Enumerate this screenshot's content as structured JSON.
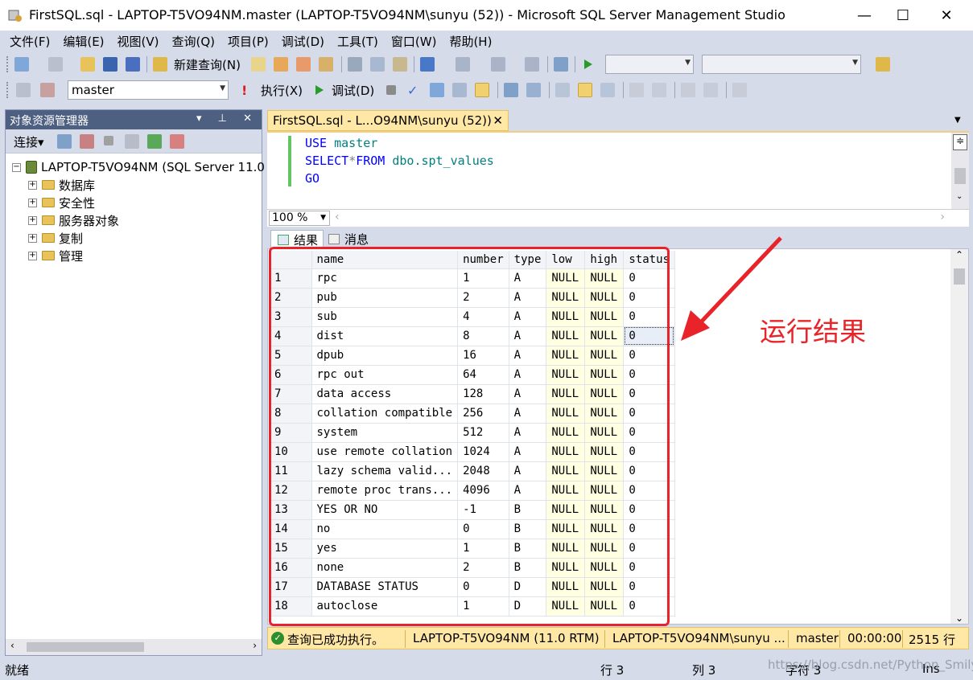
{
  "window": {
    "title": "FirstSQL.sql - LAPTOP-T5VO94NM.master (LAPTOP-T5VO94NM\\sunyu (52)) - Microsoft SQL Server Management Studio",
    "minimize": "—",
    "maximize": "☐",
    "close": "✕"
  },
  "menu": [
    "文件(F)",
    "编辑(E)",
    "视图(V)",
    "查询(Q)",
    "项目(P)",
    "调试(D)",
    "工具(T)",
    "窗口(W)",
    "帮助(H)"
  ],
  "toolbar1": {
    "new_query": "新建查询(N)"
  },
  "toolbar2": {
    "database": "master",
    "execute": "执行(X)",
    "debug": "调试(D)"
  },
  "object_explorer": {
    "title": "对象资源管理器",
    "header_buttons": "▾ 𝟦 ✕",
    "connect": "连接▾",
    "server": "LAPTOP-T5VO94NM (SQL Server 11.0",
    "nodes": [
      "数据库",
      "安全性",
      "服务器对象",
      "复制",
      "管理"
    ]
  },
  "document_tab": {
    "label": "FirstSQL.sql - L...O94NM\\sunyu (52))",
    "close": "✕"
  },
  "editor": {
    "line1_kw": "USE",
    "line1_rest": " master",
    "line2_kw1": "SELECT",
    "line2_op": "*",
    "line2_kw2": "FROM",
    "line2_obj": " dbo.spt_values",
    "line3_kw": "GO"
  },
  "zoom": "100 %",
  "result_tabs": {
    "results": "结果",
    "messages": "消息"
  },
  "grid": {
    "columns": [
      "name",
      "number",
      "type",
      "low",
      "high",
      "status"
    ],
    "rows": [
      [
        "1",
        "rpc",
        "1",
        "A",
        "NULL",
        "NULL",
        "0"
      ],
      [
        "2",
        "pub",
        "2",
        "A",
        "NULL",
        "NULL",
        "0"
      ],
      [
        "3",
        "sub",
        "4",
        "A",
        "NULL",
        "NULL",
        "0"
      ],
      [
        "4",
        "dist",
        "8",
        "A",
        "NULL",
        "NULL",
        "0"
      ],
      [
        "5",
        "dpub",
        "16",
        "A",
        "NULL",
        "NULL",
        "0"
      ],
      [
        "6",
        "rpc out",
        "64",
        "A",
        "NULL",
        "NULL",
        "0"
      ],
      [
        "7",
        "data access",
        "128",
        "A",
        "NULL",
        "NULL",
        "0"
      ],
      [
        "8",
        "collation compatible",
        "256",
        "A",
        "NULL",
        "NULL",
        "0"
      ],
      [
        "9",
        "system",
        "512",
        "A",
        "NULL",
        "NULL",
        "0"
      ],
      [
        "10",
        "use remote collation",
        "1024",
        "A",
        "NULL",
        "NULL",
        "0"
      ],
      [
        "11",
        "lazy schema valid...",
        "2048",
        "A",
        "NULL",
        "NULL",
        "0"
      ],
      [
        "12",
        "remote proc trans...",
        "4096",
        "A",
        "NULL",
        "NULL",
        "0"
      ],
      [
        "13",
        "YES OR NO",
        "-1",
        "B",
        "NULL",
        "NULL",
        "0"
      ],
      [
        "14",
        "no",
        "0",
        "B",
        "NULL",
        "NULL",
        "0"
      ],
      [
        "15",
        "yes",
        "1",
        "B",
        "NULL",
        "NULL",
        "0"
      ],
      [
        "16",
        "none",
        "2",
        "B",
        "NULL",
        "NULL",
        "0"
      ],
      [
        "17",
        "DATABASE STATUS",
        "0",
        "D",
        "NULL",
        "NULL",
        "0"
      ],
      [
        "18",
        "autoclose",
        "1",
        "D",
        "NULL",
        "NULL",
        "0"
      ]
    ]
  },
  "annotation": "运行结果",
  "query_status": {
    "message": "查询已成功执行。",
    "server": "LAPTOP-T5VO94NM (11.0 RTM)",
    "user": "LAPTOP-T5VO94NM\\sunyu ...",
    "database": "master",
    "elapsed": "00:00:00",
    "rows": "2515 行"
  },
  "status_bar": {
    "ready": "就绪",
    "line": "行 3",
    "col": "列 3",
    "char": "字符 3",
    "mode": "Ins"
  },
  "watermark": "https://blog.csdn.net/Python_Smily",
  "colors": {
    "accent_red": "#e8242a",
    "status_yellow": "#ffe8a6",
    "header_blue": "#4d6082"
  }
}
